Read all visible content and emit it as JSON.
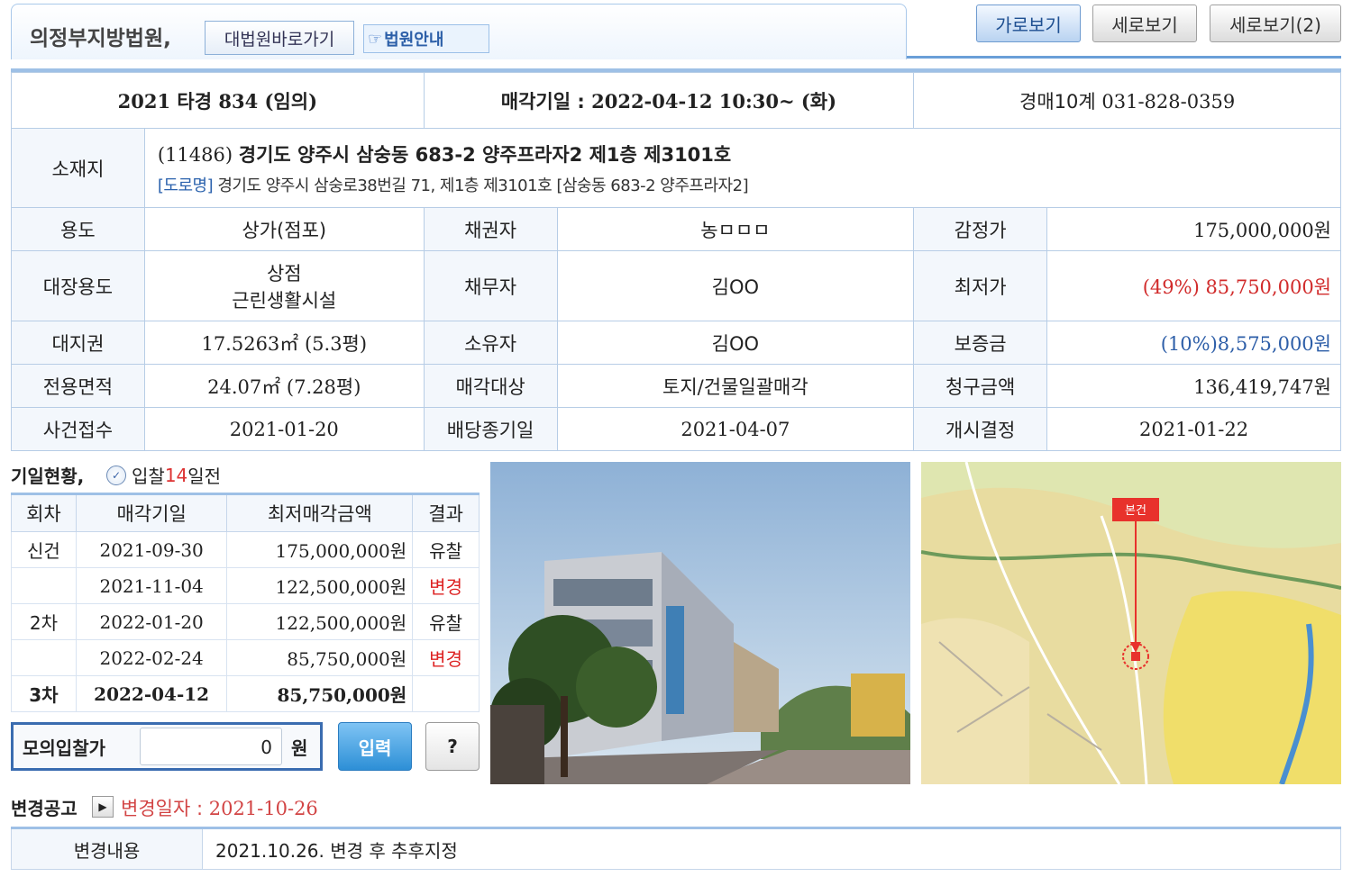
{
  "header": {
    "court_name": "의정부지방법원,",
    "court_link": "대법원바로가기",
    "court_guide": "법원안내",
    "view_buttons": [
      "가로보기",
      "세로보기",
      "세로보기(2)"
    ]
  },
  "case": {
    "number": "2021 타경 834 (임의)",
    "sale_date_label": "매각기일 :",
    "sale_date_value": "2022-04-12 10:30~ (화)",
    "department": "경매10계",
    "department_phone": "031-828-0359"
  },
  "location": {
    "label": "소재지",
    "zip": "(11486)",
    "address": "경기도 양주시 삼숭동 683-2 양주프라자2 제1층 제3101호",
    "road_tag": "[도로명]",
    "road_address": "경기도 양주시 삼숭로38번길 71, 제1층 제3101호 [삼숭동 683-2 양주프라자2]"
  },
  "details": {
    "use_label": "용도",
    "use_value": "상가(점포)",
    "creditor_label": "채권자",
    "creditor_value": "농ㅁㅁㅁ",
    "appraisal_label": "감정가",
    "appraisal_value": "175,000,000원",
    "ledger_use_label": "대장용도",
    "ledger_use_value1": "상점",
    "ledger_use_value2": "근린생활시설",
    "debtor_label": "채무자",
    "debtor_value": "김OO",
    "min_price_label": "최저가",
    "min_price_value": "(49%) 85,750,000원",
    "land_right_label": "대지권",
    "land_right_value": "17.5263㎡ (5.3평)",
    "owner_label": "소유자",
    "owner_value": "김OO",
    "deposit_label": "보증금",
    "deposit_value": "(10%)8,575,000원",
    "area_label": "전용면적",
    "area_value": "24.07㎡ (7.28평)",
    "sale_target_label": "매각대상",
    "sale_target_value": "토지/건물일괄매각",
    "claim_label": "청구금액",
    "claim_value": "136,419,747원",
    "received_label": "사건접수",
    "received_value": "2021-01-20",
    "dividend_label": "배당종기일",
    "dividend_value": "2021-04-07",
    "start_label": "개시결정",
    "start_value": "2021-01-22"
  },
  "history": {
    "title": "기일현황,",
    "bid_prefix": "입찰",
    "bid_days": "14",
    "bid_suffix": "일전",
    "columns": [
      "회차",
      "매각기일",
      "최저매각금액",
      "결과"
    ],
    "rows": [
      {
        "round": "신건",
        "date": "2021-09-30",
        "amount": "175,000,000원",
        "result": "유찰"
      },
      {
        "round": "",
        "date": "2021-11-04",
        "amount": "122,500,000원",
        "result": "변경"
      },
      {
        "round": "2차",
        "date": "2022-01-20",
        "amount": "122,500,000원",
        "result": "유찰"
      },
      {
        "round": "",
        "date": "2022-02-24",
        "amount": "85,750,000원",
        "result": "변경"
      },
      {
        "round": "3차",
        "date": "2022-04-12",
        "amount": "85,750,000원",
        "result": ""
      }
    ]
  },
  "mock_bid": {
    "label": "모의입찰가",
    "value": "0",
    "unit": "원",
    "input_button": "입력",
    "help_button": "?"
  },
  "map": {
    "tag": "본건"
  },
  "change_notice": {
    "title": "변경공고",
    "date_label": "변경일자 :",
    "date_value": "2021-10-26",
    "content_label": "변경내용",
    "content_value": "2021.10.26. 변경 후 추후지정"
  },
  "colors": {
    "accent_blue": "#9ec0e6",
    "label_bg": "#f3f7fc",
    "alert_red": "#d12b2b",
    "deposit_blue": "#2d5ea8"
  }
}
